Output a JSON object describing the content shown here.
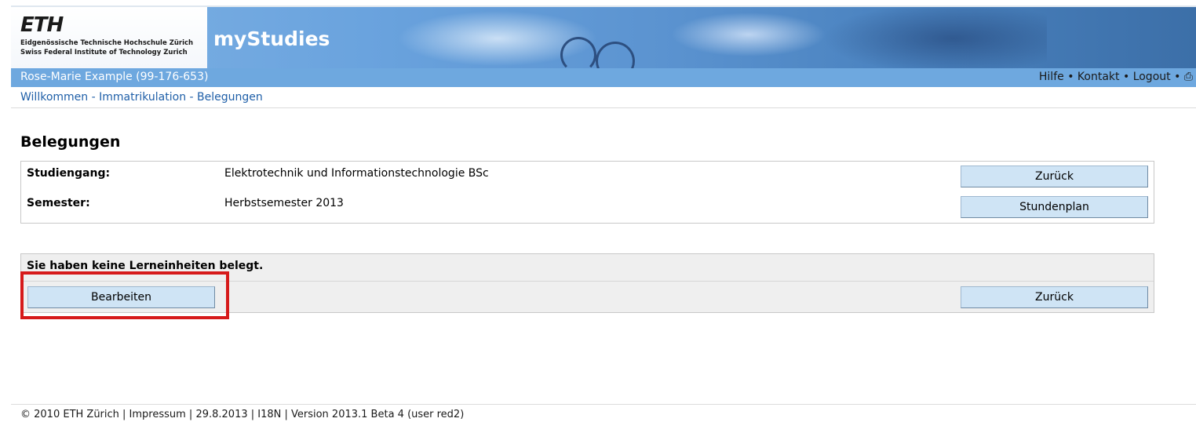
{
  "header": {
    "logo_text": "ETH",
    "institution_de": "Eidgenössische Technische Hochschule Zürich",
    "institution_en": "Swiss Federal Institute of Technology Zurich",
    "app_title": "myStudies"
  },
  "userbar": {
    "user": "Rose-Marie Example (99-176-653)",
    "links": [
      "Hilfe",
      "Kontakt",
      "Logout"
    ],
    "separator": "•"
  },
  "breadcrumb": {
    "items": [
      "Willkommen",
      "Immatrikulation",
      "Belegungen"
    ],
    "separator": "-"
  },
  "page": {
    "title": "Belegungen"
  },
  "info": {
    "studiengang_label": "Studiengang:",
    "studiengang_value": "Elektrotechnik und Informationstechnologie BSc",
    "semester_label": "Semester:",
    "semester_value": "Herbstsemester 2013",
    "back_button": "Zurück",
    "timetable_button": "Stundenplan"
  },
  "enrollment": {
    "message": "Sie haben keine Lerneinheiten belegt.",
    "edit_button": "Bearbeiten",
    "back_button": "Zurück"
  },
  "footer": {
    "text": "© 2010 ETH Zürich | Impressum | 29.8.2013 | I18N | Version 2013.1 Beta 4 (user red2)"
  },
  "colors": {
    "banner": "#6ea8df",
    "link": "#1f5fa8",
    "button": "#cfe4f5",
    "highlight": "#d61a1a"
  }
}
